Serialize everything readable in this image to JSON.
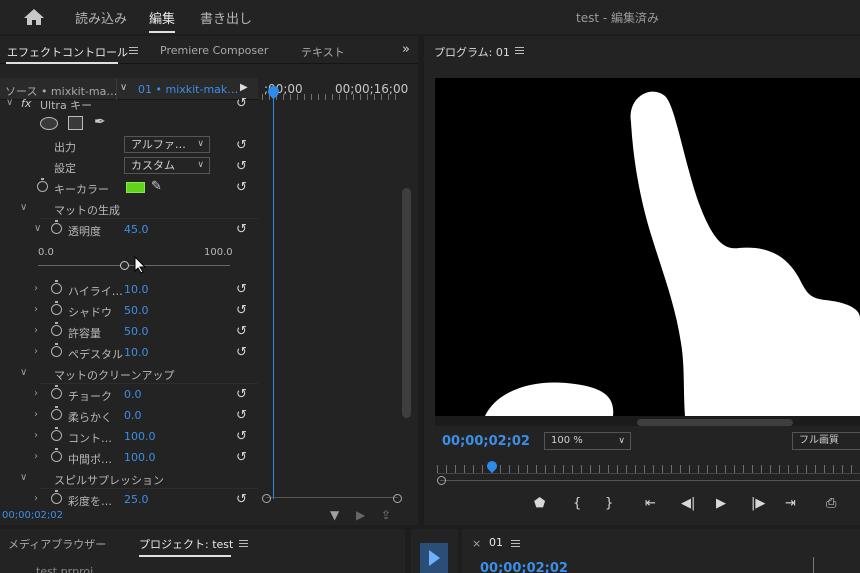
{
  "workspace": {
    "tabs": [
      "読み込み",
      "編集",
      "書き出し"
    ],
    "active": "編集",
    "doc_title": "test - 編集済み"
  },
  "left_panel": {
    "tabs": [
      "エフェクトコントロール",
      "Premiere Composer",
      "テキスト"
    ],
    "source_label": "ソース • mixkit-ma…",
    "clip_label": "01 • mixkit-mak…",
    "timeline_tc_start": ";00;00",
    "timeline_tc_end": "00;00;16;00",
    "effect_name": "Ultra キー",
    "output_label": "出力",
    "output_value": "アルファ…",
    "setting_label": "設定",
    "setting_value": "カスタム",
    "key_color_label": "キーカラー",
    "key_color": "#62d31b",
    "matte_gen_label": "マットの生成",
    "transparency_label": "透明度",
    "transparency_value": "45.0",
    "slider_min": "0.0",
    "slider_max": "100.0",
    "slider_level": 45,
    "highlight_label": "ハイライ…",
    "highlight_value": "10.0",
    "shadow_label": "シャドウ",
    "shadow_value": "50.0",
    "tolerance_label": "許容量",
    "tolerance_value": "50.0",
    "pedestal_label": "ペデスタル",
    "pedestal_value": "10.0",
    "matte_cleanup_label": "マットのクリーンアップ",
    "choke_label": "チョーク",
    "choke_value": "0.0",
    "soften_label": "柔らかく",
    "soften_value": "0.0",
    "contrast_label": "コント…",
    "contrast_value": "100.0",
    "midpoint_label": "中間ポ…",
    "midpoint_value": "100.0",
    "spill_label": "スピルサプレッション",
    "desat_label": "彩度を…",
    "desat_value": "25.0",
    "bottom_tc": "00;00;02;02"
  },
  "program": {
    "title": "プログラム: 01",
    "timecode": "00;00;02;02",
    "zoom": "100 %",
    "quality": "フル画質"
  },
  "bottom": {
    "tab_media": "メディアブラウザー",
    "tab_project": "プロジェクト: test",
    "project_file": "test.prproj",
    "seq_close": "×",
    "seq_name": "01",
    "seq_tc": "00;00;02;02"
  }
}
